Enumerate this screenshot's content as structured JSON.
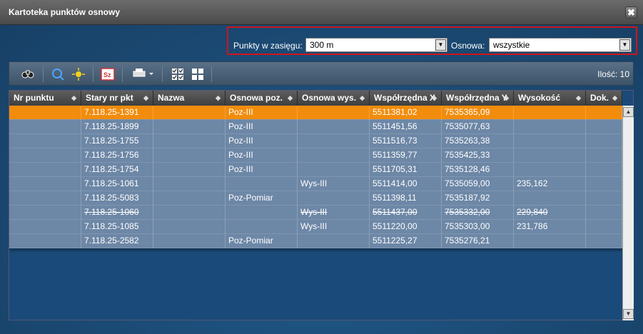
{
  "window": {
    "title": "Kartoteka punktów osnowy",
    "close_label": "✖"
  },
  "filters": {
    "range_label": "Punkty w zasięgu:",
    "range_value": "300 m",
    "osnowa_label": "Osnowa:",
    "osnowa_value": "wszystkie"
  },
  "toolbar": {
    "icons": [
      "binoculars-icon",
      "filter-icon",
      "settings-sun-icon",
      "sz-icon",
      "print-icon",
      "checklist-icon",
      "grid-icon"
    ],
    "count_label": "Ilość: 10"
  },
  "table": {
    "columns": [
      "Nr punktu",
      "Stary nr pkt",
      "Nazwa",
      "Osnowa poz.",
      "Osnowa wys.",
      "Współrzędna X",
      "Współrzędna Y",
      "Wysokość",
      "Dok."
    ],
    "rows": [
      {
        "nr": "",
        "stary": "7.118.25-1391",
        "nazwa": "",
        "poz": "Poz-III",
        "wys": "",
        "x": "5511381,02",
        "y": "7535365,09",
        "h": "",
        "dok": "",
        "selected": true,
        "strike": false
      },
      {
        "nr": "",
        "stary": "7.118.25-1899",
        "nazwa": "",
        "poz": "Poz-III",
        "wys": "",
        "x": "5511451,56",
        "y": "7535077,63",
        "h": "",
        "dok": "",
        "selected": false,
        "strike": false
      },
      {
        "nr": "",
        "stary": "7.118.25-1755",
        "nazwa": "",
        "poz": "Poz-III",
        "wys": "",
        "x": "5511516,73",
        "y": "7535263,38",
        "h": "",
        "dok": "",
        "selected": false,
        "strike": false
      },
      {
        "nr": "",
        "stary": "7.118.25-1756",
        "nazwa": "",
        "poz": "Poz-III",
        "wys": "",
        "x": "5511359,77",
        "y": "7535425,33",
        "h": "",
        "dok": "",
        "selected": false,
        "strike": false
      },
      {
        "nr": "",
        "stary": "7.118.25-1754",
        "nazwa": "",
        "poz": "Poz-III",
        "wys": "",
        "x": "5511705,31",
        "y": "7535128,46",
        "h": "",
        "dok": "",
        "selected": false,
        "strike": false
      },
      {
        "nr": "",
        "stary": "7.118.25-1061",
        "nazwa": "",
        "poz": "",
        "wys": "Wys-III",
        "x": "5511414,00",
        "y": "7535059,00",
        "h": "235,162",
        "dok": "",
        "selected": false,
        "strike": false
      },
      {
        "nr": "",
        "stary": "7.118.25-5083",
        "nazwa": "",
        "poz": "Poz-Pomiar",
        "wys": "",
        "x": "5511398,11",
        "y": "7535187,92",
        "h": "",
        "dok": "",
        "selected": false,
        "strike": false
      },
      {
        "nr": "",
        "stary": "7.118.25-1060",
        "nazwa": "",
        "poz": "",
        "wys": "Wys-III",
        "x": "5511437,00",
        "y": "7535332,00",
        "h": "229,840",
        "dok": "",
        "selected": false,
        "strike": true
      },
      {
        "nr": "",
        "stary": "7.118.25-1085",
        "nazwa": "",
        "poz": "",
        "wys": "Wys-III",
        "x": "5511220,00",
        "y": "7535303,00",
        "h": "231,786",
        "dok": "",
        "selected": false,
        "strike": false
      },
      {
        "nr": "",
        "stary": "7.118.25-2582",
        "nazwa": "",
        "poz": "Poz-Pomiar",
        "wys": "",
        "x": "5511225,27",
        "y": "7535276,21",
        "h": "",
        "dok": "",
        "selected": false,
        "strike": false
      }
    ]
  }
}
